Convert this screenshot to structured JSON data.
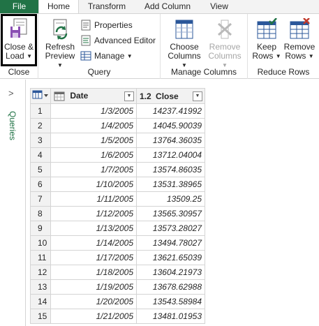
{
  "tabs": [
    {
      "label": "File"
    },
    {
      "label": "Home"
    },
    {
      "label": "Transform"
    },
    {
      "label": "Add Column"
    },
    {
      "label": "View"
    }
  ],
  "ribbon": {
    "close_group": {
      "label": "Close",
      "close_load": {
        "line1": "Close &",
        "line2": "Load"
      }
    },
    "query_group": {
      "label": "Query",
      "refresh": {
        "line1": "Refresh",
        "line2": "Preview"
      },
      "properties": "Properties",
      "advanced_editor": "Advanced Editor",
      "manage": "Manage"
    },
    "manage_columns_group": {
      "label": "Manage Columns",
      "choose": {
        "line1": "Choose",
        "line2": "Columns"
      },
      "remove": {
        "line1": "Remove",
        "line2": "Columns"
      }
    },
    "reduce_rows_group": {
      "label": "Reduce Rows",
      "keep": {
        "line1": "Keep",
        "line2": "Rows"
      },
      "remove": {
        "line1": "Remove",
        "line2": "Rows"
      }
    }
  },
  "queries_pane": {
    "label": "Queries"
  },
  "grid": {
    "columns": [
      {
        "name": "Date",
        "type_icon": "calendar-icon"
      },
      {
        "name": "Close",
        "type_label": "1.2",
        "type_icon": "decimal-type-icon"
      }
    ],
    "rows": [
      {
        "idx": "1",
        "date": "1/3/2005",
        "close": "14237.41992"
      },
      {
        "idx": "2",
        "date": "1/4/2005",
        "close": "14045.90039"
      },
      {
        "idx": "3",
        "date": "1/5/2005",
        "close": "13764.36035"
      },
      {
        "idx": "4",
        "date": "1/6/2005",
        "close": "13712.04004"
      },
      {
        "idx": "5",
        "date": "1/7/2005",
        "close": "13574.86035"
      },
      {
        "idx": "6",
        "date": "1/10/2005",
        "close": "13531.38965"
      },
      {
        "idx": "7",
        "date": "1/11/2005",
        "close": "13509.25"
      },
      {
        "idx": "8",
        "date": "1/12/2005",
        "close": "13565.30957"
      },
      {
        "idx": "9",
        "date": "1/13/2005",
        "close": "13573.28027"
      },
      {
        "idx": "10",
        "date": "1/14/2005",
        "close": "13494.78027"
      },
      {
        "idx": "11",
        "date": "1/17/2005",
        "close": "13621.65039"
      },
      {
        "idx": "12",
        "date": "1/18/2005",
        "close": "13604.21973"
      },
      {
        "idx": "13",
        "date": "1/19/2005",
        "close": "13678.62988"
      },
      {
        "idx": "14",
        "date": "1/20/2005",
        "close": "13543.58984"
      },
      {
        "idx": "15",
        "date": "1/21/2005",
        "close": "13481.01953"
      }
    ]
  },
  "colors": {
    "accent": "#217346",
    "selection_border": "#000000"
  }
}
